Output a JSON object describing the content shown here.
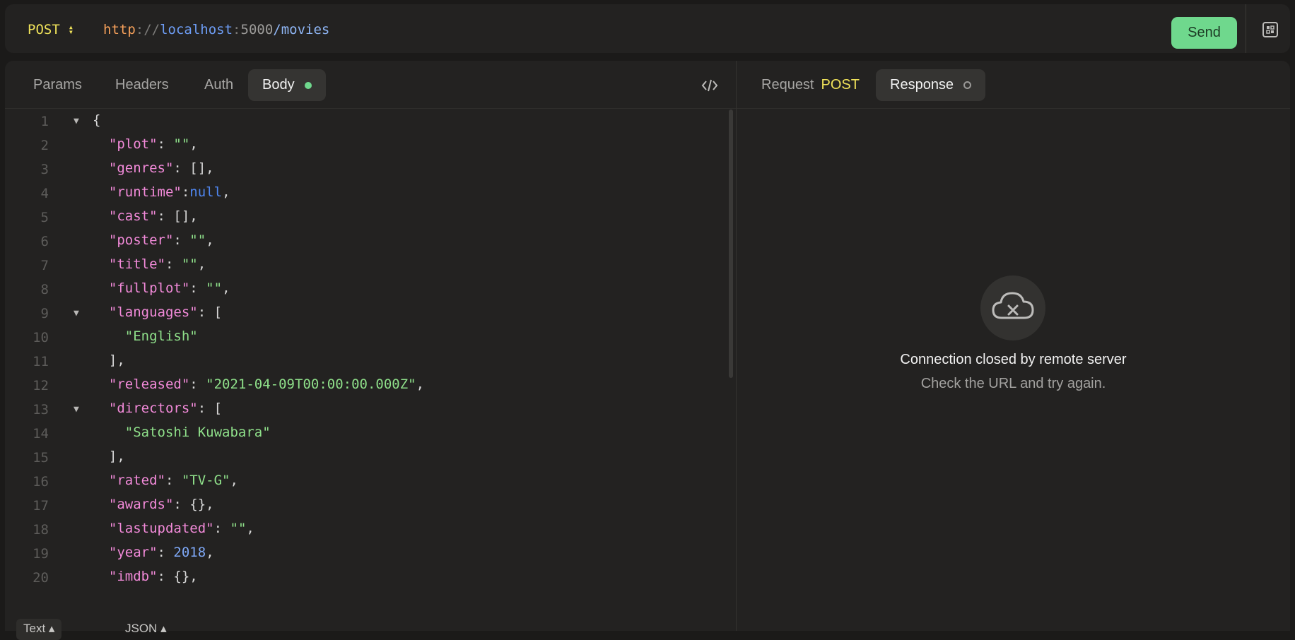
{
  "request": {
    "method": "POST",
    "url": {
      "protocol": "http",
      "separator": "://",
      "host": "localhost",
      "port_separator": ":",
      "port": "5000",
      "path": "/movies"
    },
    "send_label": "Send"
  },
  "left_tabs": {
    "params": "Params",
    "headers": "Headers",
    "auth": "Auth",
    "body": "Body"
  },
  "right_tabs": {
    "request_label": "Request",
    "request_method": "POST",
    "response_label": "Response"
  },
  "editor": {
    "line_numbers": [
      "1",
      "2",
      "3",
      "4",
      "5",
      "6",
      "7",
      "8",
      "9",
      "10",
      "11",
      "12",
      "13",
      "14",
      "15",
      "16",
      "17",
      "18",
      "19",
      "20"
    ],
    "bottom": {
      "text_mode": "Text",
      "json_mode": "JSON"
    }
  },
  "response": {
    "title": "Connection closed by remote server",
    "subtitle": "Check the URL and try again."
  },
  "colors": {
    "accent_green": "#6fd88d",
    "method_yellow": "#f0e35a",
    "json_key": "#f28ad9",
    "json_string": "#8fe08a",
    "json_number": "#7ea8f6"
  },
  "icons": [
    "chevron-updown-icon",
    "share-icon",
    "code-icon",
    "fold-arrow-icon",
    "cloud-off-icon"
  ]
}
